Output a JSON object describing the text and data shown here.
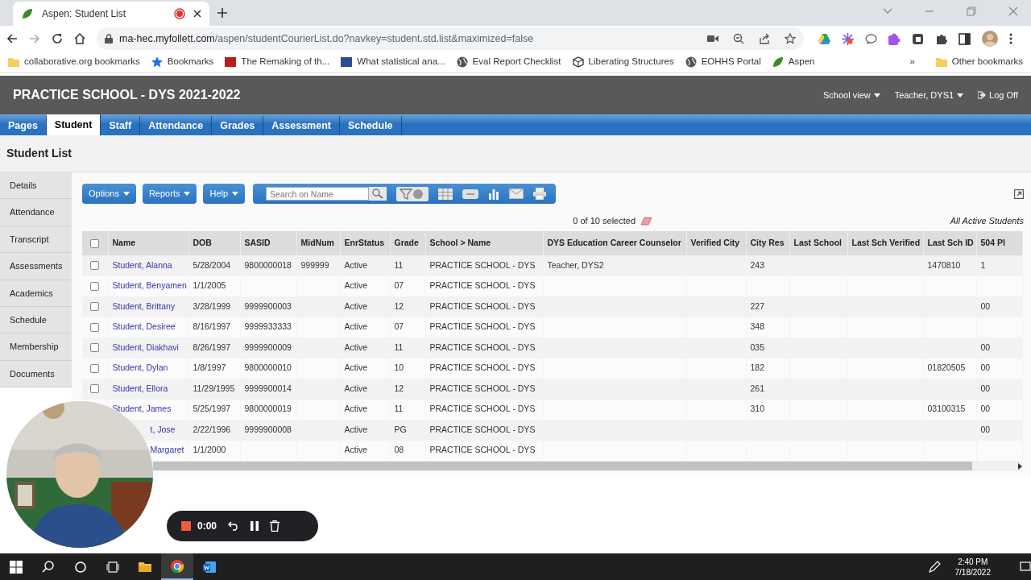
{
  "browser": {
    "tab": {
      "title": "Aspen: Student List",
      "recording": true
    },
    "url": {
      "host": "ma-hec.myfollett.com",
      "path": "/aspen/studentCourierList.do?navkey=student.std.list&maximized=false"
    },
    "bookmarks": [
      {
        "label": "collaborative.org bookmarks",
        "kind": "folder"
      },
      {
        "label": "Bookmarks",
        "kind": "star"
      },
      {
        "label": "The Remaking of th...",
        "kind": "redtile"
      },
      {
        "label": "What statistical ana...",
        "kind": "bluetile"
      },
      {
        "label": "Eval Report Checklist",
        "kind": "globe"
      },
      {
        "label": "Liberating Structures",
        "kind": "cube"
      },
      {
        "label": "EOHHS Portal",
        "kind": "globe"
      },
      {
        "label": "Aspen",
        "kind": "leaf"
      }
    ],
    "more": "»",
    "other": "Other bookmarks"
  },
  "app": {
    "school_title": "PRACTICE SCHOOL - DYS 2021-2022",
    "header_links": [
      {
        "label": "School view",
        "kind": "dropdown"
      },
      {
        "label": "Teacher, DYS1",
        "kind": "dropdown"
      },
      {
        "label": "Log Off",
        "kind": "logoff"
      }
    ],
    "tabs": [
      {
        "label": "Pages",
        "selected": false
      },
      {
        "label": "Student",
        "selected": true
      },
      {
        "label": "Staff",
        "selected": false
      },
      {
        "label": "Attendance",
        "selected": false
      },
      {
        "label": "Grades",
        "selected": false
      },
      {
        "label": "Assessment",
        "selected": false
      },
      {
        "label": "Schedule",
        "selected": false
      }
    ],
    "page_title": "Student List",
    "side_items": [
      "Details",
      "Attendance",
      "Transcript",
      "Assessments",
      "Academics",
      "Schedule",
      "Membership",
      "Documents"
    ],
    "toolbar": {
      "buttons": [
        "Options",
        "Reports",
        "Help"
      ],
      "search": {
        "placeholder": "Search on Name"
      }
    },
    "selection": "0 of 10 selected",
    "filter_name": "All Active Students",
    "table": {
      "all_checked": false,
      "columns": [
        "Name",
        "DOB",
        "SASID",
        "MidNum",
        "EnrStatus",
        "Grade",
        "School > Name",
        "DYS Education Career Counselor",
        "Verified City",
        "City Res",
        "Last School",
        "Last Sch Verified",
        "Last Sch ID",
        "504 Pl"
      ],
      "rows": [
        {
          "checked": false,
          "cells": [
            "Student, Alanna",
            "5/28/2004",
            "9800000018",
            "999999",
            "Active",
            "11",
            "PRACTICE SCHOOL - DYS",
            "Teacher, DYS2",
            null,
            "243",
            null,
            null,
            "1470810",
            "1"
          ]
        },
        {
          "checked": false,
          "cells": [
            "Student, Benyamen",
            "1/1/2005",
            null,
            null,
            "Active",
            "07",
            "PRACTICE SCHOOL - DYS",
            null,
            null,
            null,
            null,
            null,
            null,
            null
          ]
        },
        {
          "checked": false,
          "cells": [
            "Student, Brittany",
            "3/28/1999",
            "9999900003",
            null,
            "Active",
            "12",
            "PRACTICE SCHOOL - DYS",
            null,
            null,
            "227",
            null,
            null,
            null,
            "00"
          ]
        },
        {
          "checked": false,
          "cells": [
            "Student, Desiree",
            "8/16/1997",
            "9999933333",
            null,
            "Active",
            "07",
            "PRACTICE SCHOOL - DYS",
            null,
            null,
            "348",
            null,
            null,
            null,
            null
          ]
        },
        {
          "checked": false,
          "cells": [
            "Student, Diakhavi",
            "8/26/1997",
            "9999900009",
            null,
            "Active",
            "11",
            "PRACTICE SCHOOL - DYS",
            null,
            null,
            "035",
            null,
            null,
            null,
            "00"
          ]
        },
        {
          "checked": false,
          "cells": [
            "Student, Dylan",
            "1/8/1997",
            "9800000010",
            null,
            "Active",
            "10",
            "PRACTICE SCHOOL - DYS",
            null,
            null,
            "182",
            null,
            null,
            "01820505",
            "00"
          ]
        },
        {
          "checked": false,
          "cells": [
            "Student, Ellora",
            "11/29/1995",
            "9999900014",
            null,
            "Active",
            "12",
            "PRACTICE SCHOOL - DYS",
            null,
            null,
            "261",
            null,
            null,
            null,
            "00"
          ]
        },
        {
          "name_covered": false,
          "cells": [
            "Student, James",
            "5/25/1997",
            "9800000019",
            null,
            "Active",
            "11",
            "PRACTICE SCHOOL - DYS",
            null,
            null,
            "310",
            null,
            null,
            "03100315",
            "00"
          ]
        },
        {
          "name_covered": true,
          "cells": [
            "t, Jose",
            "2/22/1996",
            "9999900008",
            null,
            "Active",
            "PG",
            "PRACTICE SCHOOL - DYS",
            null,
            null,
            null,
            null,
            null,
            null,
            "00"
          ]
        },
        {
          "name_covered": true,
          "cells": [
            "Margaret",
            "1/1/2000",
            null,
            null,
            "Active",
            "08",
            "PRACTICE SCHOOL - DYS",
            null,
            null,
            null,
            null,
            null,
            null,
            null
          ]
        }
      ]
    }
  },
  "recorder": {
    "time": "0:00"
  },
  "taskbar": {
    "time": "2:40 PM",
    "date": "7/18/2022"
  }
}
